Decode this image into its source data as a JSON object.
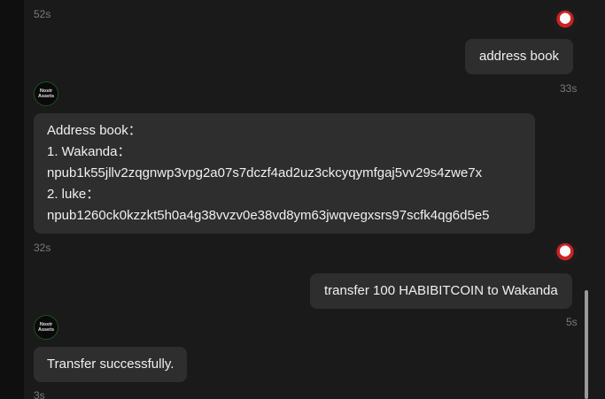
{
  "messages": [
    {
      "timestamp": "52s"
    },
    {
      "sender": "user",
      "text": "address book",
      "timestamp": "33s"
    },
    {
      "sender": "bot",
      "avatar_text": [
        "Nostr",
        "Assets"
      ],
      "lines": [
        "Address book：",
        "1. Wakanda：",
        "npub1k55jllv2zqgnwp3vpg2a07s7dczf4ad2uz3ckcyqymfgaj5vv29s4zwe7x",
        "2. luke：",
        "npub1260ck0kzzkt5h0a4g38vvzv0e38vd8ym63jwqvegxsrs97scfk4qg6d5e5"
      ],
      "timestamp": "32s"
    },
    {
      "sender": "user",
      "text": "transfer 100 HABIBITCOIN to Wakanda",
      "timestamp": "5s"
    },
    {
      "sender": "bot",
      "avatar_text": [
        "Nostr",
        "Assets"
      ],
      "text": "Transfer successfully.",
      "timestamp": "3s"
    }
  ],
  "colors": {
    "background": "#1a1a1a",
    "bubble": "#2e2e2e",
    "text": "#f0f0f0",
    "timestamp": "#7a7a7a"
  }
}
